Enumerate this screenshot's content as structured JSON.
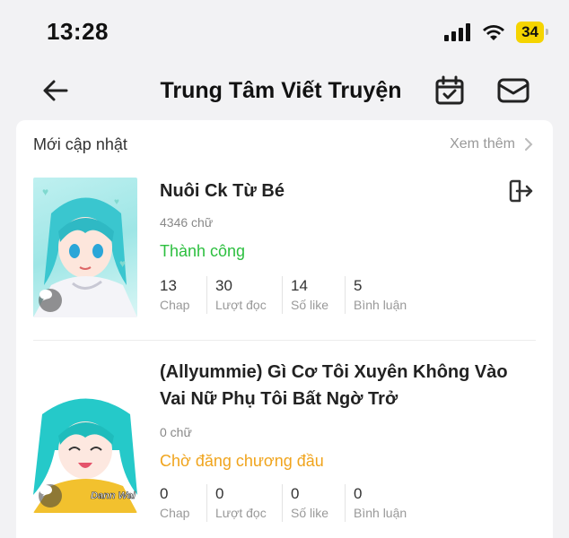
{
  "status_bar": {
    "time": "13:28",
    "battery": "34"
  },
  "header": {
    "title": "Trung Tâm Viết Truyện"
  },
  "section": {
    "title": "Mới cập nhật",
    "see_more": "Xem thêm"
  },
  "stories": [
    {
      "title": "Nuôi Ck Từ Bé",
      "words": "4346 chữ",
      "status": "Thành công",
      "status_color": "#2cbf3f",
      "stats": [
        {
          "value": "13",
          "label": "Chap"
        },
        {
          "value": "30",
          "label": "Lượt đọc"
        },
        {
          "value": "14",
          "label": "Số like"
        },
        {
          "value": "5",
          "label": "Bình luận"
        }
      ]
    },
    {
      "title": "(Allyummie) Gì Cơ Tôi Xuyên Không Vào Vai Nữ Phụ Tôi Bất Ngờ Trở",
      "words": "0 chữ",
      "status": "Chờ đăng chương đầu",
      "status_color": "#f0a41c",
      "cover_text": "Dann Wal",
      "stats": [
        {
          "value": "0",
          "label": "Chap"
        },
        {
          "value": "0",
          "label": "Lượt đọc"
        },
        {
          "value": "0",
          "label": "Số like"
        },
        {
          "value": "0",
          "label": "Bình luận"
        }
      ]
    }
  ]
}
